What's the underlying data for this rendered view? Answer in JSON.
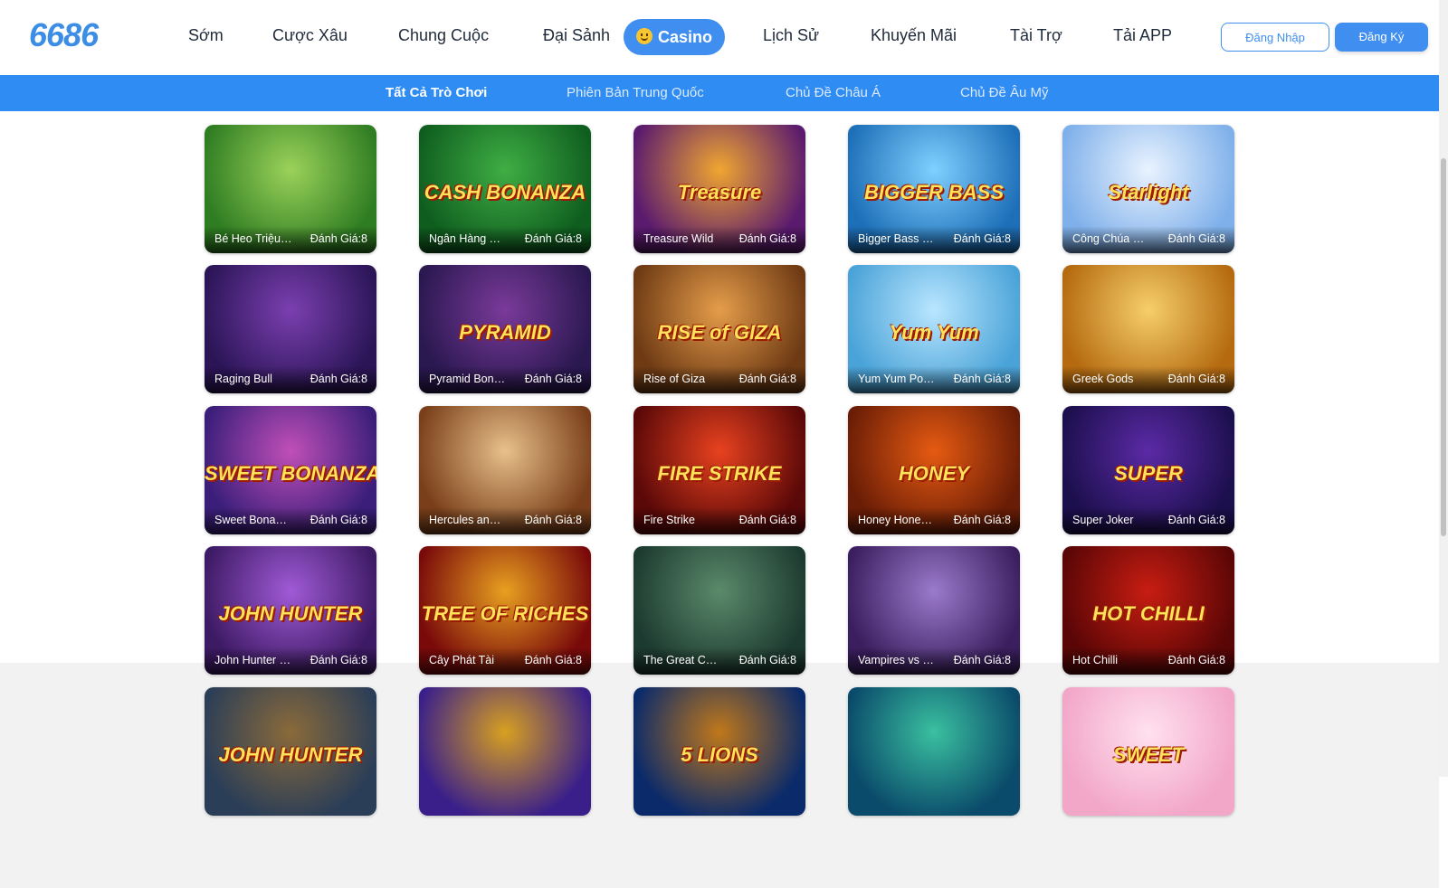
{
  "logo": "6686",
  "nav": [
    {
      "label": "Sớm"
    },
    {
      "label": "Cược Xâu"
    },
    {
      "label": "Chung Cuộc"
    },
    {
      "label": "Đại Sảnh"
    },
    {
      "label": "Casino"
    },
    {
      "label": "Lịch Sử"
    },
    {
      "label": "Khuyến Mãi"
    },
    {
      "label": "Tài Trợ"
    },
    {
      "label": "Tải APP"
    }
  ],
  "auth": {
    "login": "Đăng Nhập",
    "register": "Đăng Ký"
  },
  "subtabs": [
    {
      "label": "Tất Cả Trò Chơi"
    },
    {
      "label": "Phiên Bản Trung Quốc"
    },
    {
      "label": "Chủ Đề Châu Á"
    },
    {
      "label": "Chủ Đề Âu Mỹ"
    }
  ],
  "rating_label": "Đánh Giá:8",
  "games": [
    {
      "name": "Bé Heo Triệu Phú",
      "art": "",
      "c1": "#2f7d22",
      "c2": "#9bd25a"
    },
    {
      "name": "Ngân Hàng Tiền Mặt",
      "art": "CASH BONANZA",
      "c1": "#0f5e1f",
      "c2": "#3fae44"
    },
    {
      "name": "Treasure Wild",
      "art": "Treasure",
      "c1": "#5a1a6e",
      "c2": "#f0a631"
    },
    {
      "name": "Bigger Bass Bonanza",
      "art": "BIGGER BASS",
      "c1": "#1d6fb8",
      "c2": "#7fd0ff"
    },
    {
      "name": "Công Chúa Ánh Sao",
      "art": "Starlight",
      "c1": "#7fb0ea",
      "c2": "#e9f3ff"
    },
    {
      "name": "Raging Bull",
      "art": "",
      "c1": "#2b1557",
      "c2": "#7b3fb0"
    },
    {
      "name": "Pyramid Bonanza",
      "art": "PYRAMID",
      "c1": "#2a1850",
      "c2": "#7a3a9a"
    },
    {
      "name": "Rise of Giza",
      "art": "RISE of GIZA",
      "c1": "#6e3a14",
      "c2": "#e59d4a"
    },
    {
      "name": "Yum Yum Powerways",
      "art": "Yum Yum",
      "c1": "#4aa3d8",
      "c2": "#b9e6ff"
    },
    {
      "name": "Greek Gods",
      "art": "",
      "c1": "#b56a10",
      "c2": "#f6cf6a"
    },
    {
      "name": "Sweet Bonanza Xmas",
      "art": "SWEET BONANZA",
      "c1": "#3a1e7a",
      "c2": "#c04fb8"
    },
    {
      "name": "Hercules and Pegasus",
      "art": "",
      "c1": "#7a3f1a",
      "c2": "#e8c08a"
    },
    {
      "name": "Fire Strike",
      "art": "FIRE STRIKE",
      "c1": "#5a0808",
      "c2": "#e8421f"
    },
    {
      "name": "Honey Honey Honey",
      "art": "HONEY",
      "c1": "#6a1d06",
      "c2": "#e65a12"
    },
    {
      "name": "Super Joker",
      "art": "SUPER",
      "c1": "#1c0f4d",
      "c2": "#5b2aa6"
    },
    {
      "name": "John Hunter and the Tomb of the Scarab Queen",
      "art": "JOHN HUNTER",
      "c1": "#3d1a64",
      "c2": "#a05ad6"
    },
    {
      "name": "Cây Phát Tài",
      "art": "TREE OF RICHES",
      "c1": "#7a0a0a",
      "c2": "#e8a020"
    },
    {
      "name": "The Great Chicken Escape",
      "art": "",
      "c1": "#1d3a30",
      "c2": "#5a8a6a"
    },
    {
      "name": "Vampires vs Wolves",
      "art": "",
      "c1": "#3a1e5e",
      "c2": "#9a7acc"
    },
    {
      "name": "Hot Chilli",
      "art": "HOT CHILLI",
      "c1": "#5a0606",
      "c2": "#c81d12"
    },
    {
      "name": "",
      "art": "JOHN HUNTER",
      "c1": "#2b3e57",
      "c2": "#8a6a3a"
    },
    {
      "name": "",
      "art": "",
      "c1": "#3a1f8a",
      "c2": "#d8a020"
    },
    {
      "name": "",
      "art": "5 LIONS",
      "c1": "#0a2a6a",
      "c2": "#c0781a"
    },
    {
      "name": "",
      "art": "",
      "c1": "#0a4a6a",
      "c2": "#3ac0a0"
    },
    {
      "name": "",
      "art": "SWEET",
      "c1": "#f2a6c8",
      "c2": "#ffe1ef"
    }
  ]
}
